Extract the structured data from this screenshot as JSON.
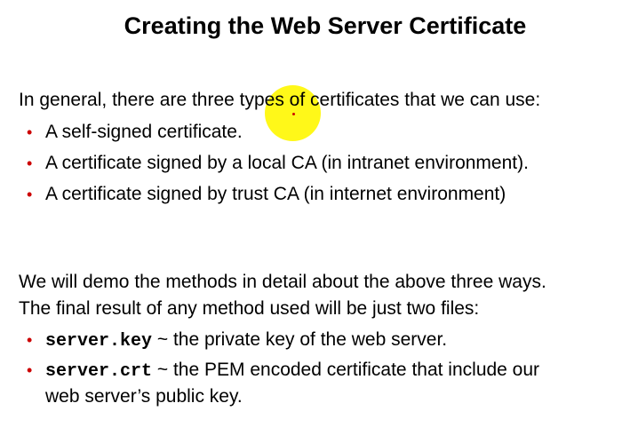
{
  "slide": {
    "title": "Creating the Web Server Certificate",
    "intro": "In general, there are three types of certificates that we can use:",
    "types": [
      "A self-signed certificate.",
      "A certificate signed by a local CA (in intranet environment).",
      "A certificate signed by trust CA (in internet environment)"
    ],
    "demo_line1": "We will demo the methods in detail about the above three ways.",
    "demo_line2": "The final result of any method used will be just two files:",
    "files": [
      {
        "name": "server.key",
        "description": " ~ the private key of the web server."
      },
      {
        "name": "server.crt",
        "description": " ~ the PEM encoded certificate that include our",
        "description_cont": "web server’s public key."
      }
    ],
    "bullet_glyph": "•"
  },
  "colors": {
    "bullet": "#cc0000",
    "text": "#000000",
    "pointer_highlight": "#fff700",
    "background": "#ffffff"
  }
}
